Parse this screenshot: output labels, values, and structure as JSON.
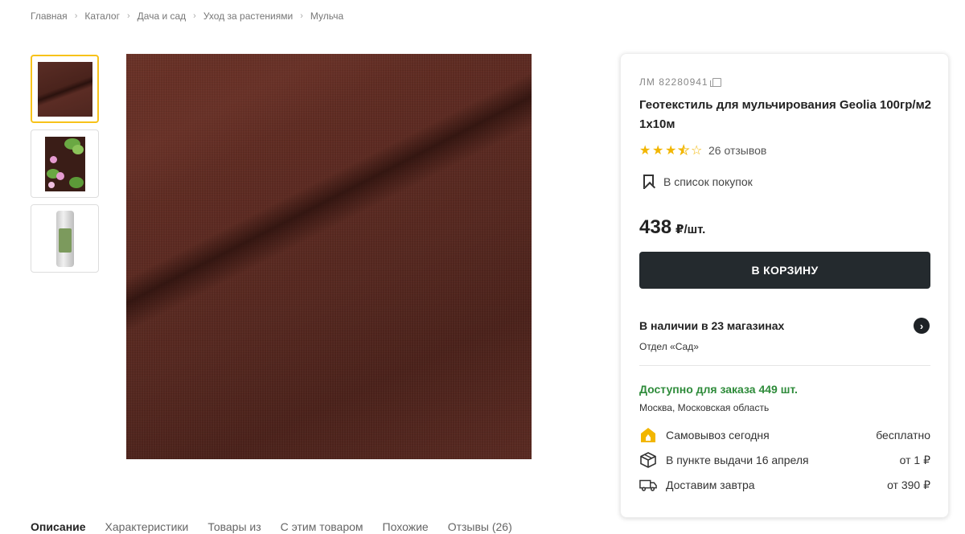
{
  "breadcrumb": [
    "Главная",
    "Каталог",
    "Дача и сад",
    "Уход за растениями",
    "Мульча"
  ],
  "gallery": {
    "thumbnails": [
      "fabric",
      "garden",
      "roll"
    ]
  },
  "tabs": [
    "Описание",
    "Характеристики",
    "Товары из",
    "С этим товаром",
    "Похожие",
    "Отзывы (26)"
  ],
  "product": {
    "sku": "ЛМ 82280941",
    "title": "Геотекстиль для мульчирования Geolia 100гр/м2 1х10м",
    "rating": 3.5,
    "reviews": "26 отзывов",
    "shopping_list": "В список покупок",
    "price": "438",
    "price_unit": "₽/шт.",
    "cart_button": "В КОРЗИНУ",
    "availability": "В наличии в 23 магазинах",
    "department": "Отдел «Сад»",
    "order_available": "Доступно для заказа 449 шт.",
    "region": "Москва, Московская область"
  },
  "delivery": [
    {
      "icon": "pickup-store-icon",
      "label": "Самовывоз сегодня",
      "value": "бесплатно"
    },
    {
      "icon": "box-icon",
      "label": "В пункте выдачи 16 апреля",
      "value": "от 1 ₽"
    },
    {
      "icon": "truck-icon",
      "label": "Доставим завтра",
      "value": "от 390 ₽"
    }
  ],
  "colors": {
    "accent_yellow": "#f7c21a",
    "button_dark": "#242a2e",
    "stock_green": "#2e8b3a"
  }
}
